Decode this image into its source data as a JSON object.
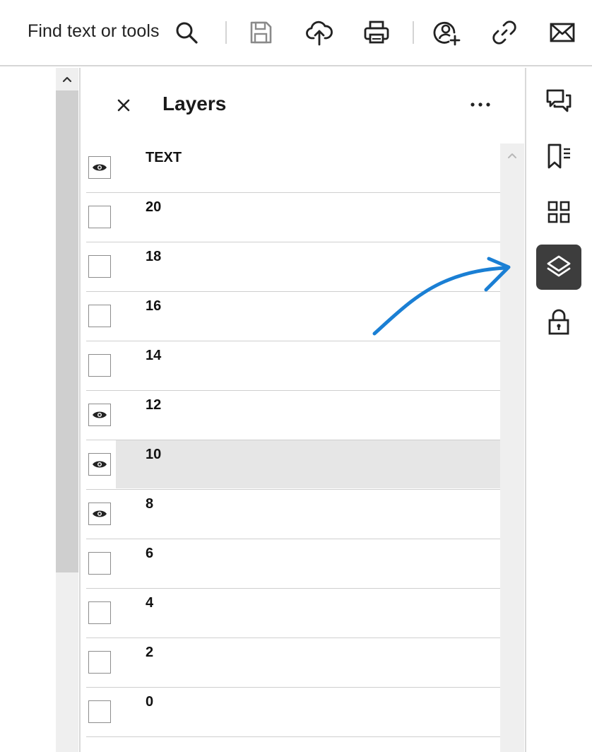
{
  "toolbar": {
    "find_text": "Find text or tools",
    "icons": [
      "search-icon",
      "save-icon",
      "cloud-upload-icon",
      "print-icon",
      "add-user-icon",
      "link-icon",
      "email-icon"
    ]
  },
  "panel": {
    "title": "Layers",
    "close_icon": "close-icon",
    "more_icon": "more-options-icon"
  },
  "layers": [
    {
      "label": "TEXT",
      "visible": true,
      "selected": false
    },
    {
      "label": "20",
      "visible": false,
      "selected": false
    },
    {
      "label": "18",
      "visible": false,
      "selected": false
    },
    {
      "label": "16",
      "visible": false,
      "selected": false
    },
    {
      "label": "14",
      "visible": false,
      "selected": false
    },
    {
      "label": "12",
      "visible": true,
      "selected": false
    },
    {
      "label": "10",
      "visible": true,
      "selected": true
    },
    {
      "label": "8",
      "visible": true,
      "selected": false
    },
    {
      "label": "6",
      "visible": false,
      "selected": false
    },
    {
      "label": "4",
      "visible": false,
      "selected": false
    },
    {
      "label": "2",
      "visible": false,
      "selected": false
    },
    {
      "label": "0",
      "visible": false,
      "selected": false
    }
  ],
  "rail": {
    "items": [
      {
        "icon": "comments-icon",
        "active": false
      },
      {
        "icon": "bookmarks-icon",
        "active": false
      },
      {
        "icon": "thumbnails-icon",
        "active": false
      },
      {
        "icon": "layers-icon",
        "active": true
      },
      {
        "icon": "lock-icon",
        "active": false
      }
    ]
  },
  "colors": {
    "annotation_arrow": "#1a7fd4",
    "active_rail": "#3d3d3d",
    "selected_row": "#e6e6e6"
  }
}
